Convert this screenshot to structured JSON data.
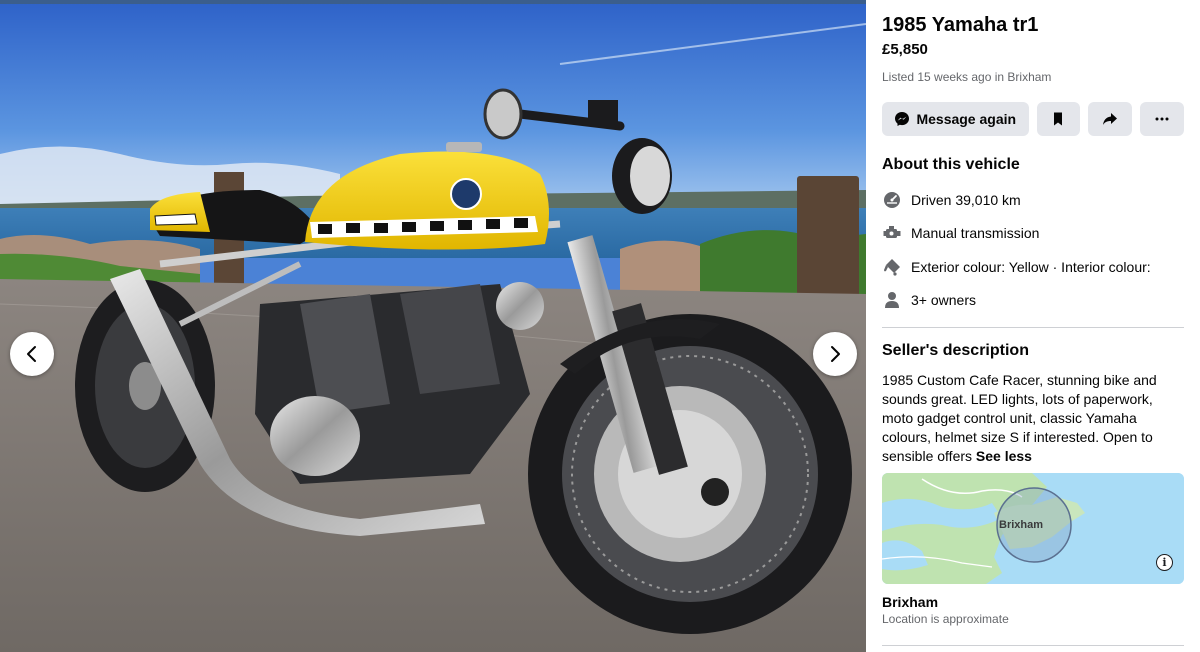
{
  "listing": {
    "title": "1985 Yamaha tr1",
    "price": "£5,850",
    "listed": "Listed 15 weeks ago in Brixham"
  },
  "actions": {
    "message_label": "Message again",
    "save_icon": "bookmark-icon",
    "share_icon": "share-icon",
    "more_icon": "more-icon"
  },
  "about": {
    "title": "About this vehicle",
    "specs": [
      {
        "icon": "speedometer-icon",
        "text": "Driven 39,010 km"
      },
      {
        "icon": "transmission-icon",
        "text": "Manual transmission"
      },
      {
        "icon": "paint-icon",
        "text": "Exterior colour: Yellow · Interior colour:"
      },
      {
        "icon": "person-icon",
        "text": "3+ owners"
      }
    ]
  },
  "description": {
    "title": "Seller's description",
    "text": "1985 Custom Cafe Racer, stunning bike and sounds great. LED lights, lots of paperwork, moto gadget control unit, classic Yamaha colours, helmet size S if interested. Open to sensible offers ",
    "see_less": "See less"
  },
  "location": {
    "map_label": "Brixham",
    "name": "Brixham",
    "approx": "Location is approximate"
  },
  "colors": {
    "accent_button_bg": "#e4e6eb",
    "secondary_text": "#65676b",
    "bike_yellow": "#f2cd0f"
  }
}
